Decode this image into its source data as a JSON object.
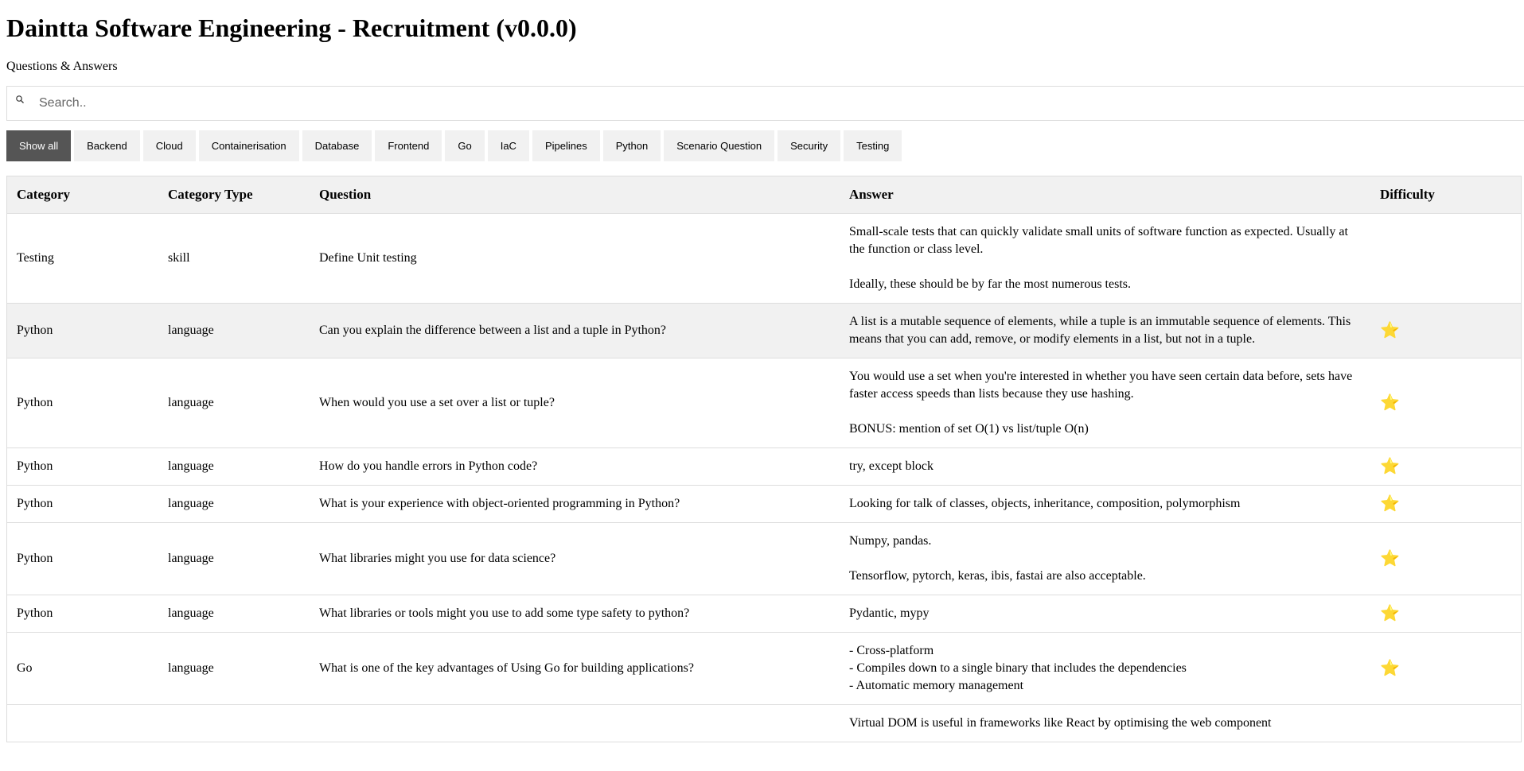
{
  "header": {
    "title": "Daintta Software Engineering - Recruitment (v0.0.0)",
    "subtitle": "Questions & Answers"
  },
  "search": {
    "placeholder": "Search.."
  },
  "filters": [
    {
      "label": "Show all",
      "active": true
    },
    {
      "label": "Backend"
    },
    {
      "label": "Cloud"
    },
    {
      "label": "Containerisation"
    },
    {
      "label": "Database"
    },
    {
      "label": "Frontend"
    },
    {
      "label": "Go"
    },
    {
      "label": "IaC"
    },
    {
      "label": "Pipelines"
    },
    {
      "label": "Python"
    },
    {
      "label": "Scenario Question"
    },
    {
      "label": "Security"
    },
    {
      "label": "Testing"
    }
  ],
  "table": {
    "headers": [
      "Category",
      "Category Type",
      "Question",
      "Answer",
      "Difficulty"
    ],
    "rows": [
      {
        "category": "Testing",
        "type": "skill",
        "question": "Define Unit testing",
        "answer": "Small-scale tests that can quickly validate small units of software function as expected. Usually at the function or class level.\n\nIdeally, these should be by far the most numerous tests.",
        "difficulty": ""
      },
      {
        "category": "Python",
        "type": "language",
        "question": "Can you explain the difference between a list and a tuple in Python?",
        "answer": "A list is a mutable sequence of elements, while a tuple is an immutable sequence of elements. This means that you can add, remove, or modify elements in a list, but not in a tuple.",
        "difficulty": "⭐",
        "highlight": true
      },
      {
        "category": "Python",
        "type": "language",
        "question": "When would you use a set over a list or tuple?",
        "answer": "You would use a set when you're interested in whether you have seen certain data before, sets have faster access speeds than lists because they use hashing.\n\nBONUS: mention of set O(1) vs list/tuple O(n)",
        "difficulty": "⭐"
      },
      {
        "category": "Python",
        "type": "language",
        "question": "How do you handle errors in Python code?",
        "answer": "try, except block",
        "difficulty": "⭐"
      },
      {
        "category": "Python",
        "type": "language",
        "question": "What is your experience with object-oriented programming in Python?",
        "answer": "Looking for talk of classes, objects, inheritance, composition, polymorphism",
        "difficulty": "⭐"
      },
      {
        "category": "Python",
        "type": "language",
        "question": "What libraries might you use for data science?",
        "answer": "Numpy, pandas.\n\nTensorflow, pytorch, keras, ibis, fastai are also acceptable.",
        "difficulty": "⭐"
      },
      {
        "category": "Python",
        "type": "language",
        "question": "What libraries or tools might you use to add some type safety to python?",
        "answer": "Pydantic, mypy",
        "difficulty": "⭐"
      },
      {
        "category": "Go",
        "type": "language",
        "question": "What is one of the key advantages of Using Go for building applications?",
        "answer": "- Cross-platform\n- Compiles down to a single binary that includes the dependencies\n- Automatic memory management",
        "difficulty": "⭐"
      },
      {
        "category": "",
        "type": "",
        "question": "",
        "answer": "Virtual DOM is useful in frameworks like React by optimising the web component",
        "difficulty": ""
      }
    ]
  }
}
